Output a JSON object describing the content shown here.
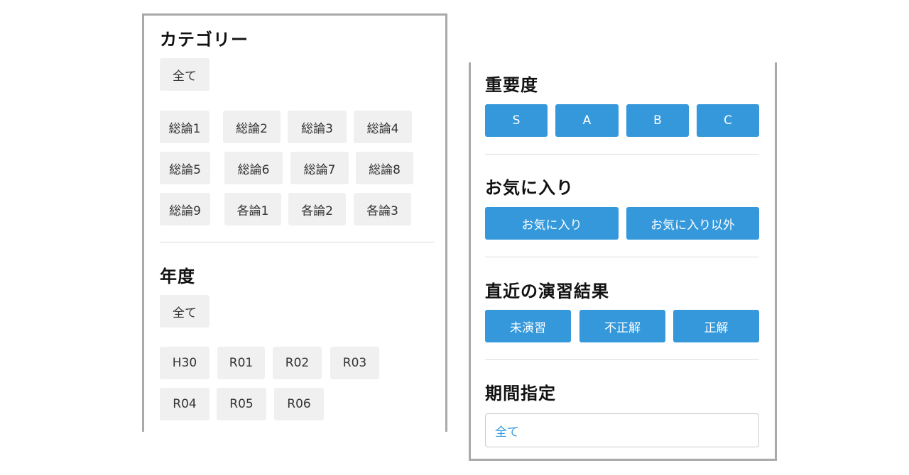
{
  "left_panel": {
    "category": {
      "title": "カテゴリー",
      "all_label": "全て",
      "items": [
        "総論1",
        "総論2",
        "総論3",
        "総論4",
        "総論5",
        "総論6",
        "総論7",
        "総論8",
        "総論9",
        "各論1",
        "各論2",
        "各論3"
      ]
    },
    "year": {
      "title": "年度",
      "all_label": "全て",
      "items": [
        "H30",
        "R01",
        "R02",
        "R03",
        "R04",
        "R05",
        "R06"
      ]
    }
  },
  "right_panel": {
    "importance": {
      "title": "重要度",
      "options": [
        "S",
        "A",
        "B",
        "C"
      ]
    },
    "favorites": {
      "title": "お気に入り",
      "options": [
        "お気に入り",
        "お気に入り以外"
      ]
    },
    "recent_result": {
      "title": "直近の演習結果",
      "options": [
        "未演習",
        "不正解",
        "正解"
      ]
    },
    "period": {
      "title": "期間指定",
      "value": "全て"
    }
  },
  "colors": {
    "accent": "#3498db",
    "chip_bg": "#f0f0f0",
    "border": "#a9a9a9"
  }
}
